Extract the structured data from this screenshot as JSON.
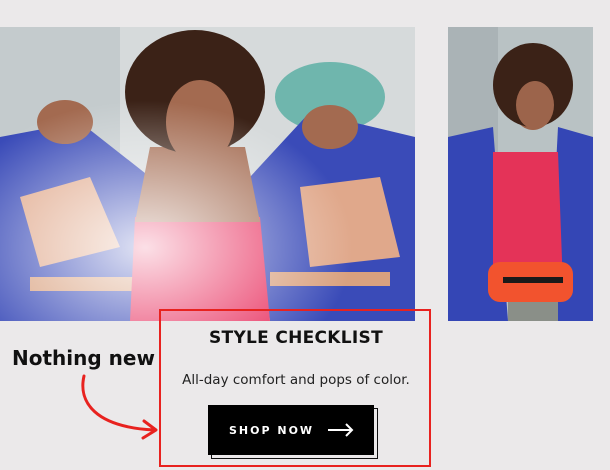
{
  "promo": {
    "title": "STYLE CHECKLIST",
    "subtitle": "All-day comfort and pops of color.",
    "cta_label": "SHOP NOW"
  },
  "annotation": {
    "text": "Nothing new",
    "color": "#e8221f"
  },
  "colors": {
    "page_bg": "#ebe9ea",
    "button_bg": "#000000",
    "button_text": "#ffffff",
    "highlight": "#e8221f"
  },
  "icons": {
    "cta_icon": "arrow-right-icon",
    "annotation_icon": "curved-arrow-icon"
  }
}
